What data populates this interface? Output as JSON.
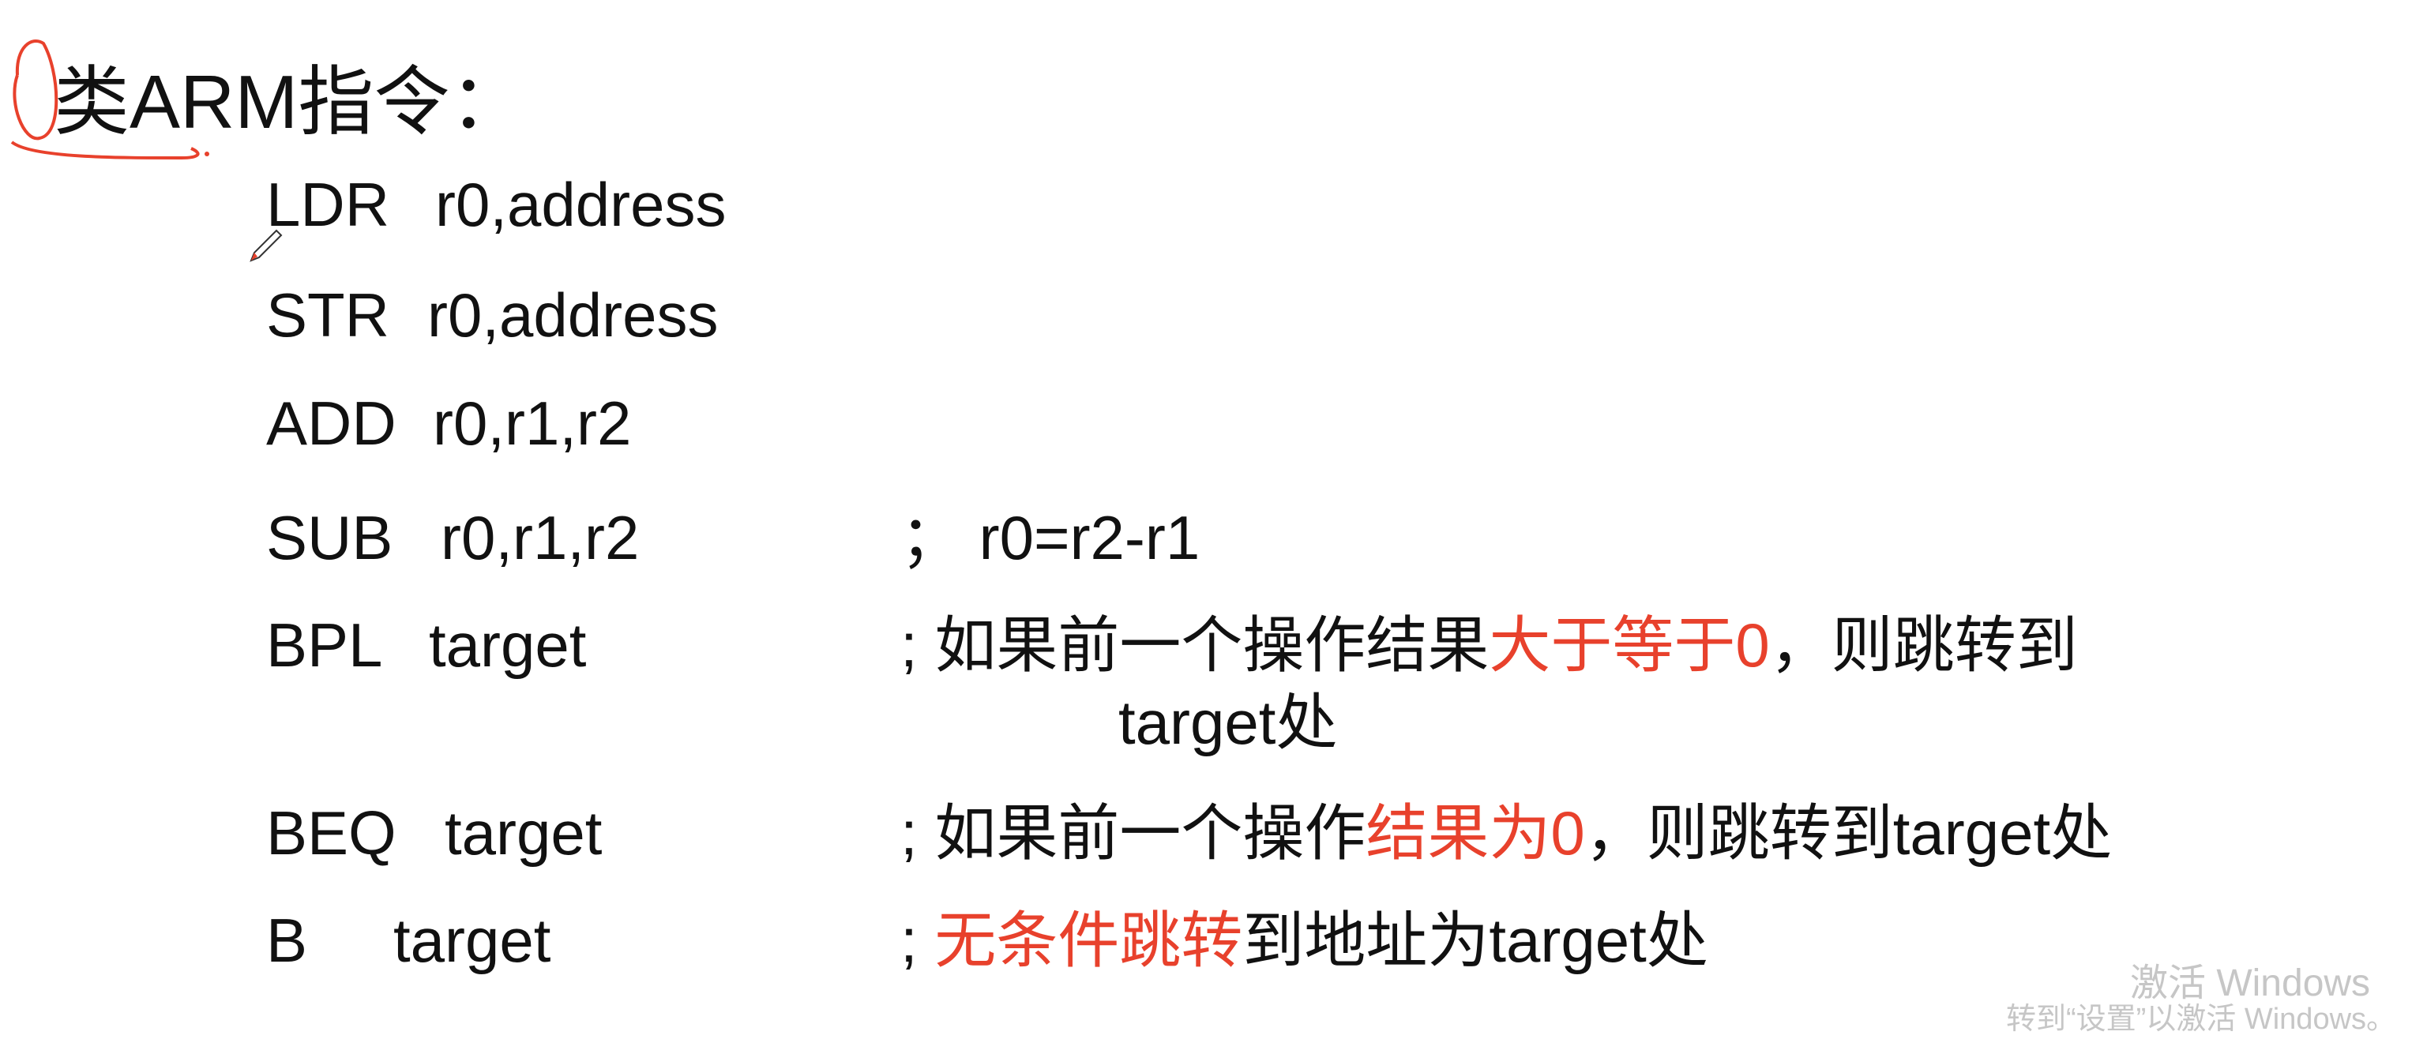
{
  "slide": {
    "title": "类ARM指令：",
    "instructions": [
      {
        "mnemonic": "LDR",
        "operands": "r0,address",
        "comment": []
      },
      {
        "mnemonic": "STR",
        "operands": "r0,address",
        "comment": []
      },
      {
        "mnemonic": "ADD",
        "operands": "r0,r1,r2",
        "comment": []
      },
      {
        "mnemonic": "SUB",
        "operands": "r0,r1,r2",
        "comment": [
          {
            "text": "；  r0=r2-r1",
            "highlight": false
          }
        ]
      },
      {
        "mnemonic": "BPL",
        "operands": "target",
        "comment": [
          {
            "text": "; 如果前一个操作结果",
            "highlight": false
          },
          {
            "text": "大于等于0",
            "highlight": true
          },
          {
            "text": "，则跳转到",
            "highlight": false
          }
        ],
        "continuation": "target处"
      },
      {
        "mnemonic": "BEQ",
        "operands": "target",
        "comment": [
          {
            "text": "; 如果前一个操作",
            "highlight": false
          },
          {
            "text": "结果为0",
            "highlight": true
          },
          {
            "text": "，则跳转到target处",
            "highlight": false
          }
        ]
      },
      {
        "mnemonic": "B",
        "operands": "target",
        "comment": [
          {
            "text": "; ",
            "highlight": false
          },
          {
            "text": "无条件跳转",
            "highlight": true
          },
          {
            "text": "到地址为target处",
            "highlight": false
          }
        ]
      }
    ]
  },
  "watermark": {
    "line1": "激活 Windows",
    "line2": "转到“设置”以激活 Windows。"
  },
  "colors": {
    "highlight": "#e8412c",
    "annotation": "#e8412c",
    "watermark": "#c6c6c6"
  }
}
